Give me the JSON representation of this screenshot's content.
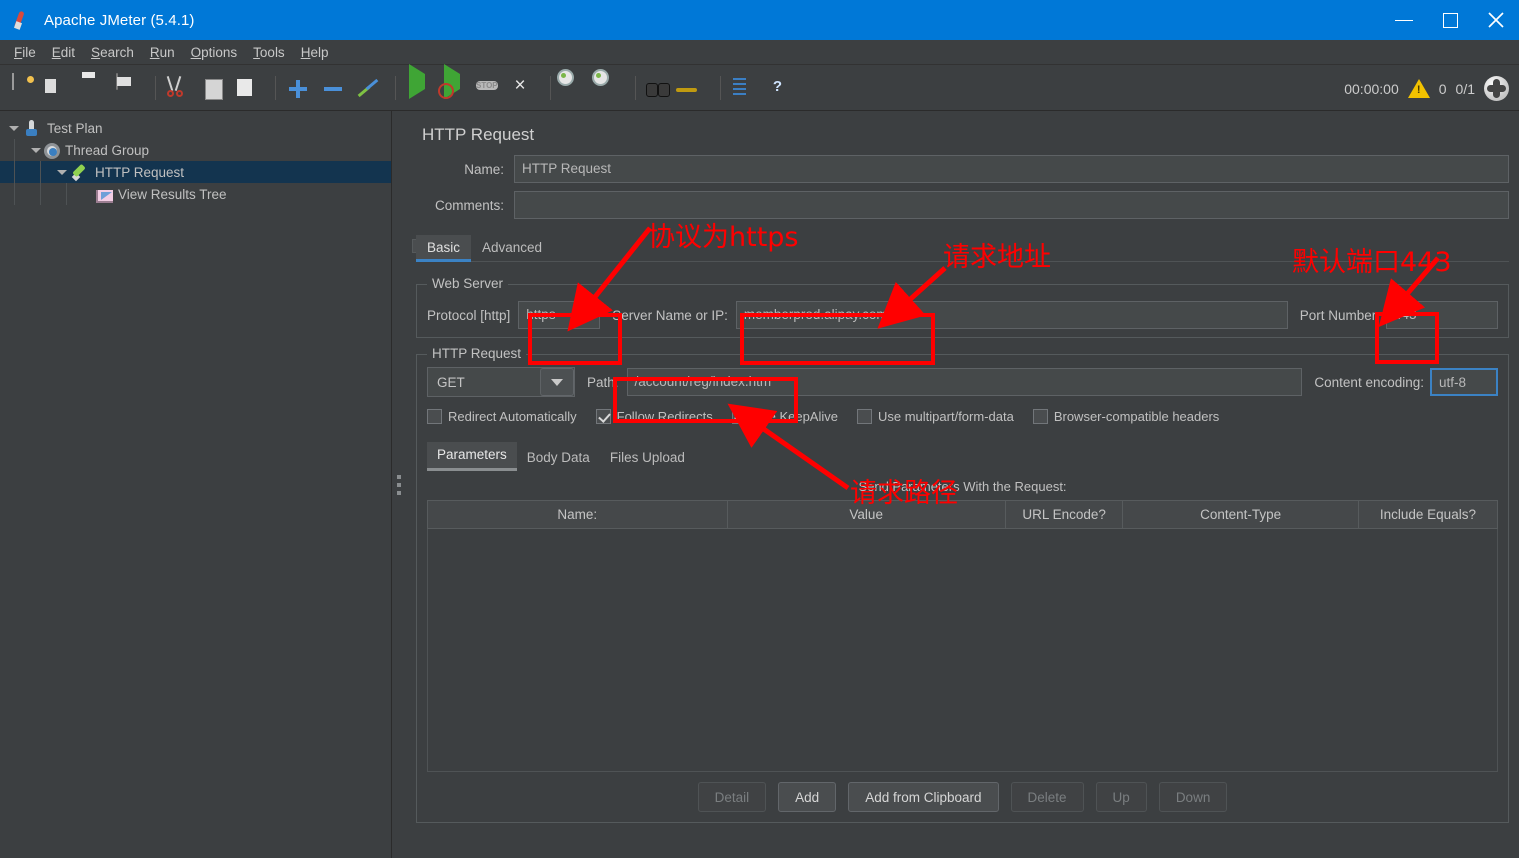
{
  "window": {
    "title": "Apache JMeter (5.4.1)",
    "icon": "jmeter-feather-icon",
    "controls": {
      "minimize": "minimize-icon",
      "maximize": "maximize-icon",
      "close": "close-icon"
    }
  },
  "menubar": {
    "items": [
      {
        "label": "File",
        "mnemonic": "F"
      },
      {
        "label": "Edit",
        "mnemonic": "E"
      },
      {
        "label": "Search",
        "mnemonic": "S"
      },
      {
        "label": "Run",
        "mnemonic": "R"
      },
      {
        "label": "Options",
        "mnemonic": "O"
      },
      {
        "label": "Tools",
        "mnemonic": "T"
      },
      {
        "label": "Help",
        "mnemonic": "H"
      }
    ]
  },
  "toolbar": {
    "icons": [
      "new-document-icon",
      "templates-icon",
      "open-icon",
      "save-icon",
      "cut-icon",
      "copy-icon",
      "paste-icon",
      "expand-all-icon",
      "collapse-all-icon",
      "toggle-icon",
      "start-icon",
      "start-no-pauses-icon",
      "stop-icon",
      "shutdown-icon",
      "clear-icon",
      "clear-all-icon",
      "search-icon",
      "search-reset-icon",
      "function-helper-icon",
      "help-icon"
    ],
    "status": {
      "elapsed_time": "00:00:00",
      "warning_icon": "warning-triangle-icon",
      "error_count": "0",
      "thread_count": "0/1",
      "activity_icon": "remote-status-icon"
    }
  },
  "tree": {
    "nodes": [
      {
        "label": "Test Plan",
        "icon": "test-plan-icon",
        "depth": 0,
        "expanded": true,
        "selected": false
      },
      {
        "label": "Thread Group",
        "icon": "thread-group-icon",
        "depth": 1,
        "expanded": true,
        "selected": false
      },
      {
        "label": "HTTP Request",
        "icon": "http-request-icon",
        "depth": 2,
        "expanded": true,
        "selected": true
      },
      {
        "label": "View Results Tree",
        "icon": "view-results-tree-icon",
        "depth": 3,
        "expanded": false,
        "selected": false
      }
    ]
  },
  "panel": {
    "title": "HTTP Request",
    "name_label": "Name:",
    "name_value": "HTTP Request",
    "comments_label": "Comments:",
    "comments_value": "",
    "tabs": [
      {
        "label": "Basic",
        "active": true
      },
      {
        "label": "Advanced",
        "active": false
      }
    ],
    "web_server": {
      "legend": "Web Server",
      "protocol_label": "Protocol [http]",
      "protocol_value": "https",
      "server_label": "Server Name or IP:",
      "server_value": "memberprod.alipay.com",
      "port_label": "Port Number:",
      "port_value": "443"
    },
    "http_request": {
      "legend": "HTTP Request",
      "method_value": "GET",
      "path_label": "Path:",
      "path_value": "/account/reg/index.htm",
      "content_encoding_label": "Content encoding:",
      "content_encoding_value": "utf-8",
      "checkboxes": [
        {
          "label": "Redirect Automatically",
          "checked": false
        },
        {
          "label": "Follow Redirects",
          "checked": true
        },
        {
          "label": "Use KeepAlive",
          "checked": true
        },
        {
          "label": "Use multipart/form-data",
          "checked": false
        },
        {
          "label": "Browser-compatible headers",
          "checked": false
        }
      ]
    },
    "param_tabs": [
      {
        "label": "Parameters",
        "active": true
      },
      {
        "label": "Body Data",
        "active": false
      },
      {
        "label": "Files Upload",
        "active": false
      }
    ],
    "send_params_label": "Send Parameters With the Request:",
    "table": {
      "columns": [
        "Name:",
        "Value",
        "URL Encode?",
        "Content-Type",
        "Include Equals?"
      ],
      "rows": []
    },
    "buttons": [
      {
        "label": "Detail",
        "enabled": false
      },
      {
        "label": "Add",
        "enabled": true
      },
      {
        "label": "Add from Clipboard",
        "enabled": true
      },
      {
        "label": "Delete",
        "enabled": false
      },
      {
        "label": "Up",
        "enabled": false
      },
      {
        "label": "Down",
        "enabled": false
      }
    ]
  },
  "annotations": {
    "color": "#ff0000",
    "items": [
      {
        "text": "协议为https",
        "target": "protocol-field"
      },
      {
        "text": "请求地址",
        "target": "server-name-field"
      },
      {
        "text": "默认端口443",
        "target": "port-number-field"
      },
      {
        "text": "请求路径",
        "target": "path-field"
      }
    ]
  }
}
